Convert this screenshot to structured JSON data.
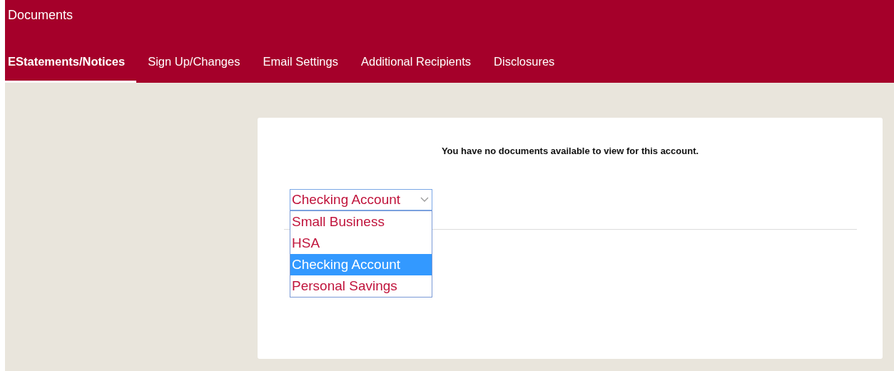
{
  "header": {
    "title": "Documents"
  },
  "tabs": [
    {
      "label": "EStatements/Notices",
      "selected": true
    },
    {
      "label": "Sign Up/Changes",
      "selected": false
    },
    {
      "label": "Email Settings",
      "selected": false
    },
    {
      "label": "Additional Recipients",
      "selected": false
    },
    {
      "label": "Disclosures",
      "selected": false
    }
  ],
  "message": "You have no documents available to view for this account.",
  "account_select": {
    "value": "Checking Account",
    "expanded": true,
    "options": [
      {
        "label": "Small Business",
        "selected": false
      },
      {
        "label": "HSA",
        "selected": false
      },
      {
        "label": "Checking Account",
        "selected": true
      },
      {
        "label": "Personal Savings",
        "selected": false
      }
    ]
  }
}
